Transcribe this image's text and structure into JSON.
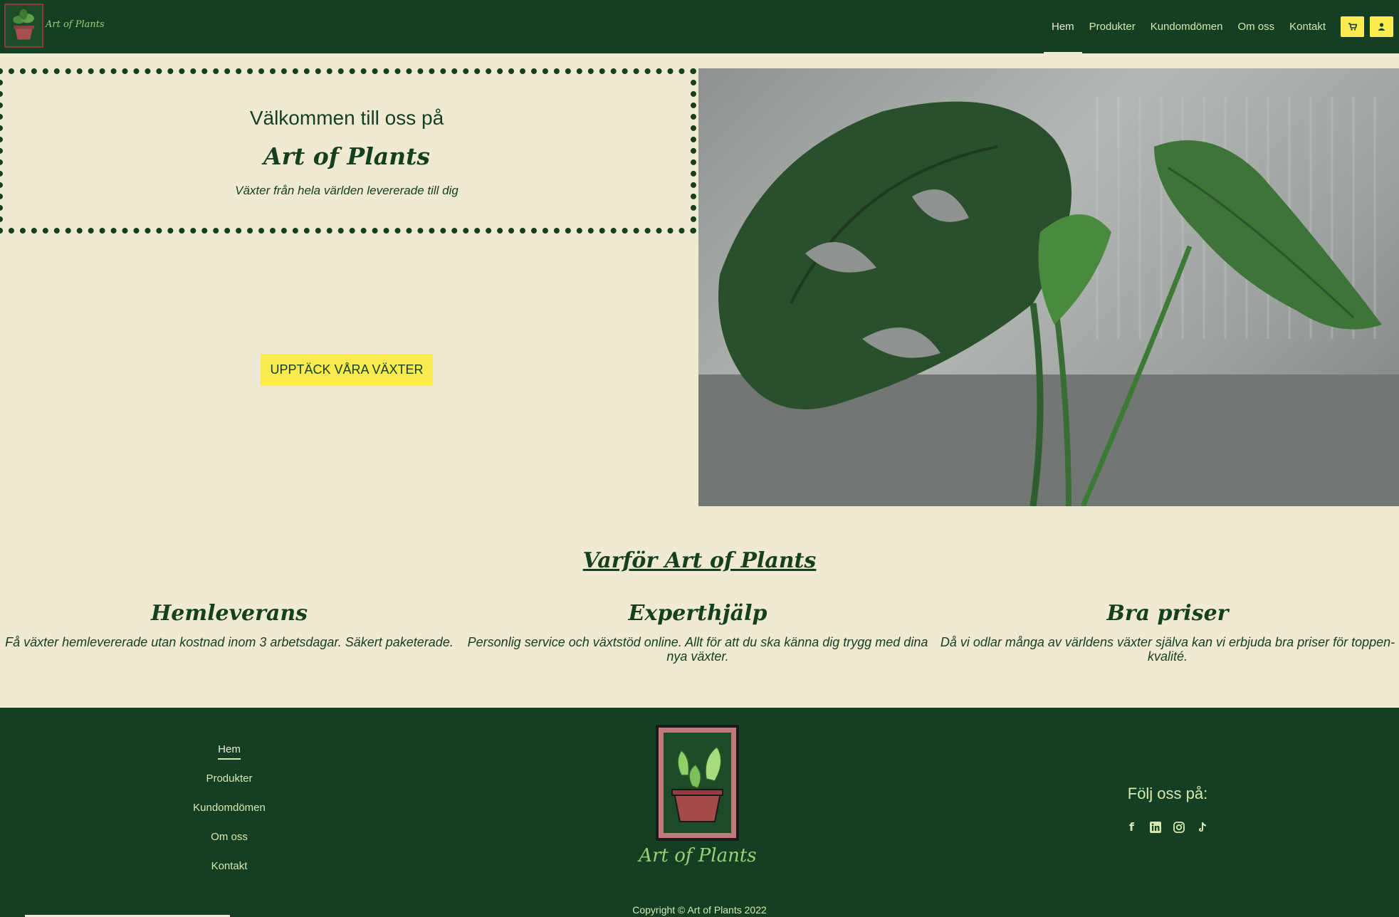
{
  "nav": {
    "brand": "Art of Plants",
    "links": [
      "Hem",
      "Produkter",
      "Kundomdömen",
      "Om oss",
      "Kontakt"
    ],
    "active": "Hem",
    "cart_icon": "cart-icon",
    "account_icon": "user-icon"
  },
  "hero": {
    "welcome": "Välkommen till oss på",
    "brand": "Art of Plants",
    "subtitle": "Växter från hela världen levererade till dig",
    "cta": "UPPTÄCK VÅRA VÄXTER"
  },
  "why": {
    "title": "Varför Art of Plants",
    "features": [
      {
        "title": "Hemleverans",
        "text": "Få växter hemlevererade utan kostnad inom 3 arbetsdagar. Säkert paketerade."
      },
      {
        "title": "Experthjälp",
        "text": "Personlig service och växtstöd online. Allt för att du ska känna dig trygg med dina nya växter."
      },
      {
        "title": "Bra priser",
        "text": "Då vi odlar många av världens växter själva kan vi erbjuda bra priser för toppen-kvalité."
      }
    ]
  },
  "footer": {
    "links": [
      "Hem",
      "Produkter",
      "Kundomdömen",
      "Om oss",
      "Kontakt"
    ],
    "brand": "Art of Plants",
    "follow": "Följ oss på:",
    "social": [
      "facebook-icon",
      "linkedin-icon",
      "instagram-icon",
      "tiktok-icon"
    ],
    "copyright": "Copyright © Art of Plants 2022"
  },
  "colors": {
    "dark_green": "#153f22",
    "cream": "#f1ead2",
    "yellow": "#fbeb4f",
    "light_green": "#d6e9b1"
  }
}
